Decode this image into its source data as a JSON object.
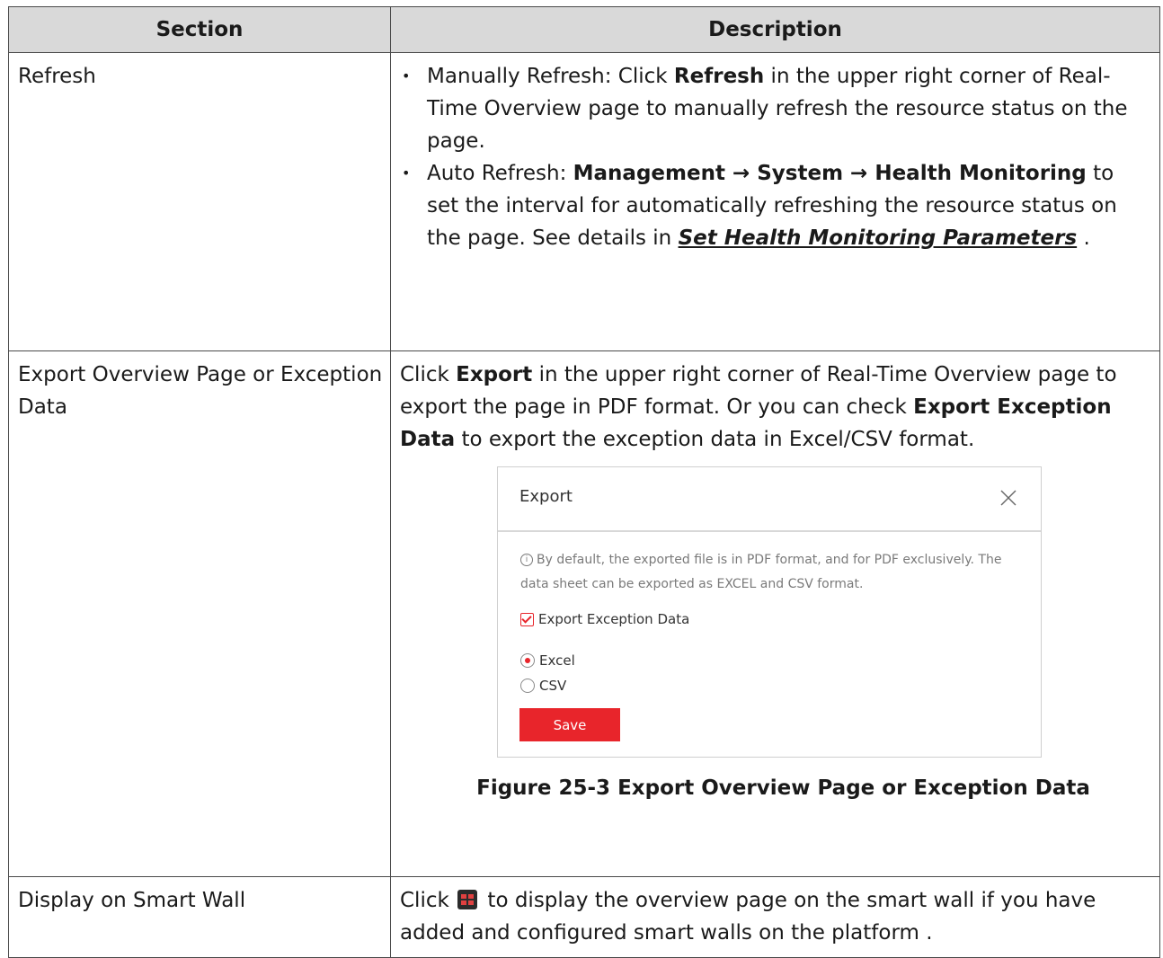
{
  "table": {
    "headers": [
      "Section",
      "Description"
    ],
    "row_refresh": {
      "section": "Refresh",
      "bullet1_label": "Manually Refresh: Click ",
      "bullet1_bold": "Refresh",
      "bullet1_rest": " in the upper right corner of Real-Time Overview page to manually refresh the resource status on the page.",
      "bullet2_label": "Auto Refresh: ",
      "bullet2_bold": "Management → System → Health Monitoring",
      "bullet2_rest": " to set the interval for automatically refreshing the resource status on the page. See details in ",
      "bullet2_link": "Set Health Monitoring Parameters",
      "bullet2_end": " ."
    },
    "row_export": {
      "section": "Export Overview Page or Exception Data",
      "text1": "Click ",
      "bold1": "Export",
      "text2": " in the upper right corner of Real-Time Overview page to export the page in PDF format. Or you can check ",
      "bold2": "Export Exception Data",
      "text3": " to export the exception data in Excel/CSV format.",
      "caption": "Figure 25-3 Export Overview Page or Exception Data"
    },
    "row_wall": {
      "section": "Display on Smart Wall",
      "text1": "Click ",
      "text2": " to display the overview page on the smart wall if you have added and configured smart walls on the platform ."
    }
  },
  "dialog": {
    "title": "Export",
    "note": "By default, the exported file is in PDF format, and for PDF exclusively. The data sheet can be exported as EXCEL and CSV format.",
    "checkbox_label": "Export Exception Data",
    "checkbox_checked": true,
    "options": [
      "Excel",
      "CSV"
    ],
    "selected_option": "Excel",
    "save_label": "Save",
    "accent_color": "#e8252b"
  },
  "icons": {
    "close": "close-icon",
    "info": "info-icon",
    "smart_wall": "smart-wall-icon"
  }
}
